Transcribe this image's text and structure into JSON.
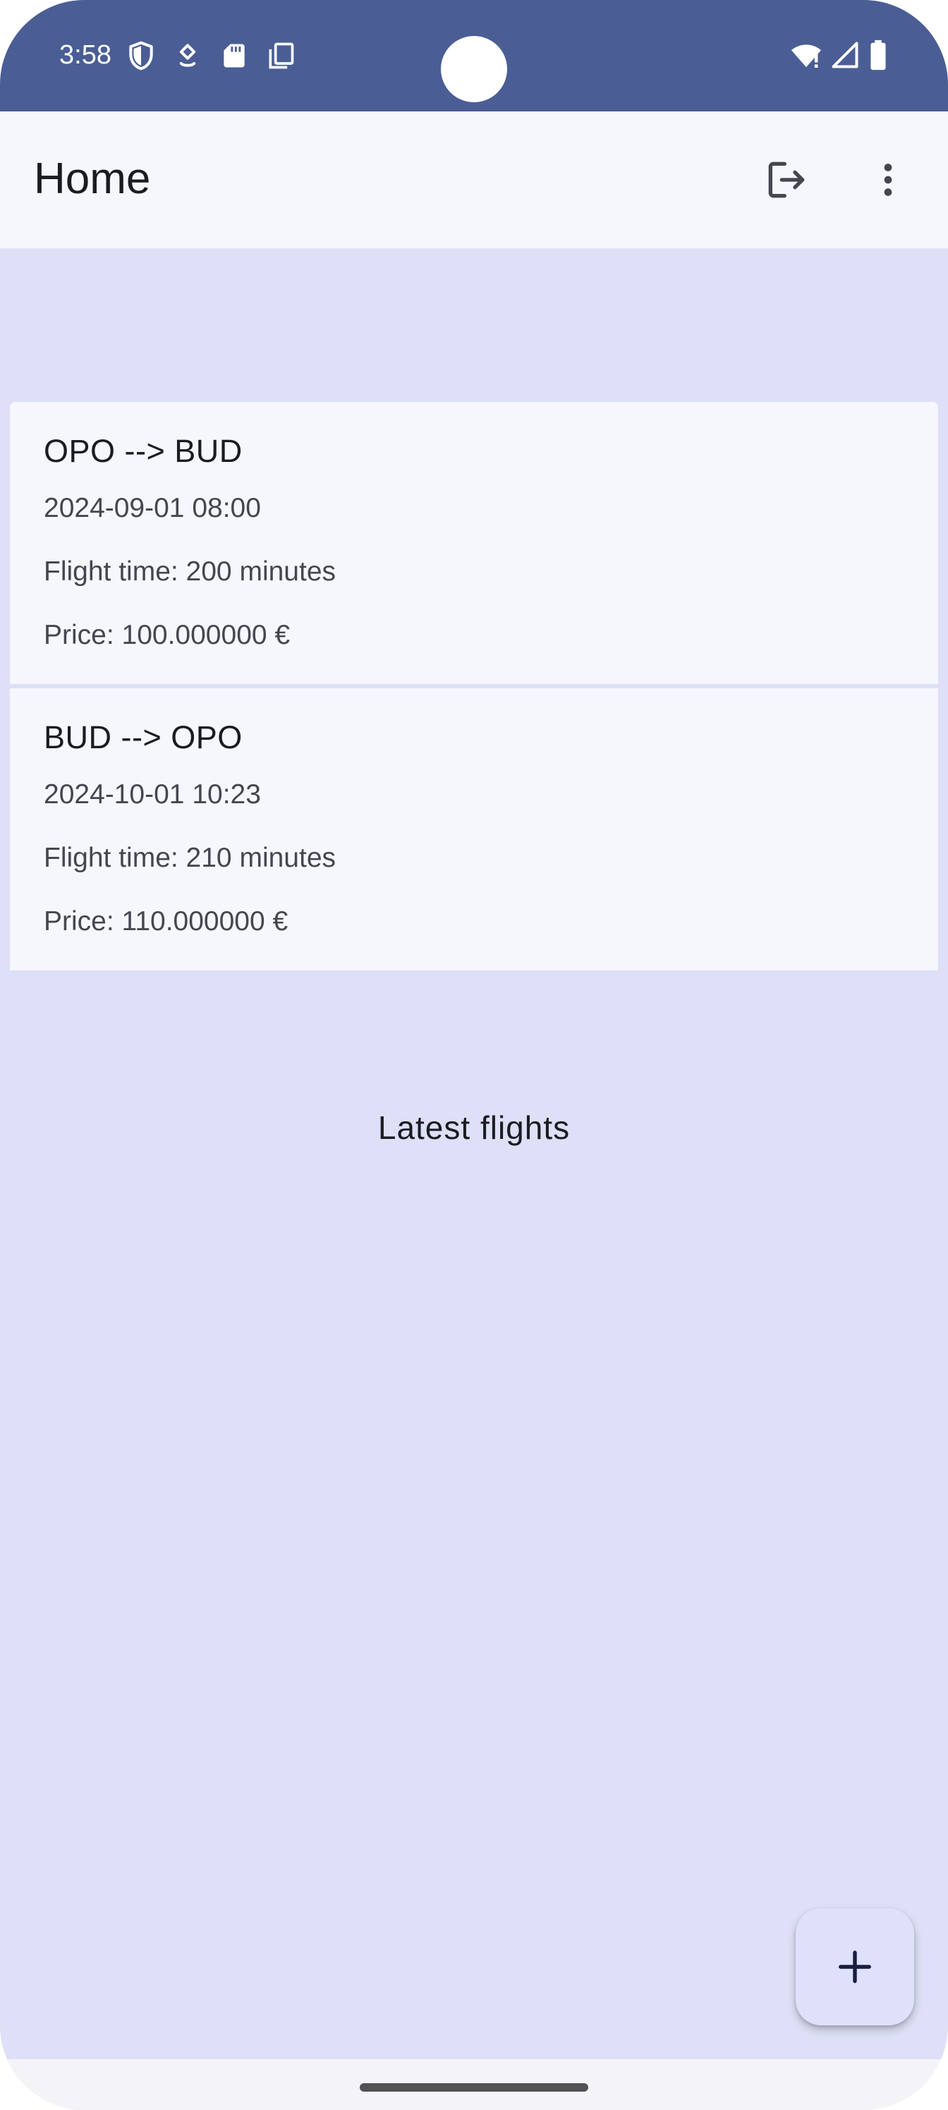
{
  "status_bar": {
    "time": "3:58",
    "left_icons": [
      "shield-icon",
      "location-pin-icon",
      "sd-card-icon",
      "copy-icon"
    ],
    "right_icons": [
      "wifi-alert-icon",
      "cellular-signal-icon",
      "battery-icon"
    ],
    "background": "#4a5d95"
  },
  "app_bar": {
    "title": "Home",
    "actions": [
      "logout-icon",
      "more-vert-icon"
    ],
    "background": "#f6f6fd"
  },
  "flights": [
    {
      "route": "OPO --> BUD",
      "datetime": "2024-09-01 08:00",
      "duration": "Flight time: 200 minutes",
      "price": "Price: 100.000000 €"
    },
    {
      "route": "BUD --> OPO",
      "datetime": "2024-10-01 10:23",
      "duration": "Flight time: 210 minutes",
      "price": "Price: 110.000000 €"
    }
  ],
  "section_label": "Latest flights",
  "fab": {
    "icon": "plus-icon",
    "background": "#dfe1fb"
  },
  "theme": {
    "page_background": "#dde0f6",
    "card_background": "#f6f6fd",
    "text_primary": "#1b1b22",
    "text_secondary": "#45464f"
  }
}
